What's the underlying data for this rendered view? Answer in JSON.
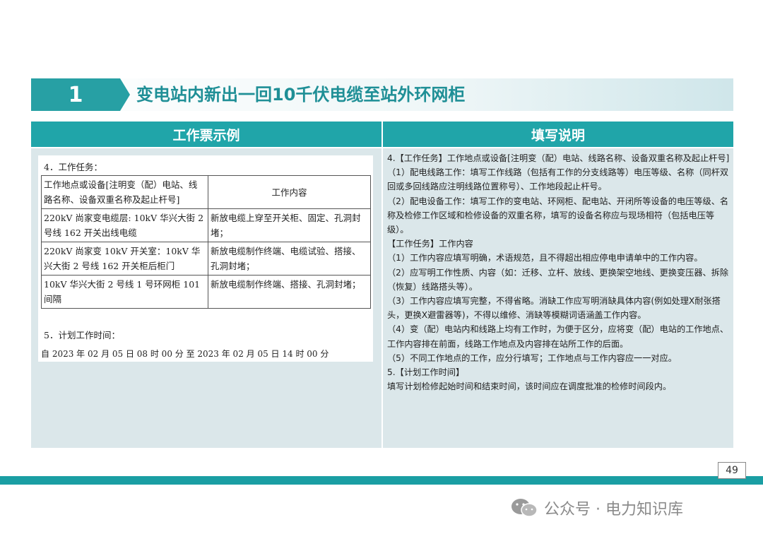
{
  "title": {
    "number": "1",
    "text": "变电站内新出一回10千伏电缆至站外环网柜"
  },
  "columns": {
    "left_header": "工作票示例",
    "right_header": "填写说明"
  },
  "example": {
    "section4": "4．工作任务：",
    "table_head": {
      "location": "工作地点或设备[注明变（配）电站、线路名称、设备双重名称及起止杆号]",
      "content": "工作内容"
    },
    "rows": [
      {
        "location": "220kV 尚家变电缆层: 10kV 华兴大街 2 号线 162 开关出线电缆",
        "content": "新放电缆上穿至开关柜、固定、孔洞封堵；"
      },
      {
        "location": "220kV 尚家变 10kV 开关室：10kV 华兴大街 2 号线 162 开关柜后柜门",
        "content": "新放电缆制作终端、电缆试验、搭接、孔洞封堵；"
      },
      {
        "location": "10kV 华兴大街 2 号线 1 号环网柜 101 间隔",
        "content": "新放电缆制作终端、搭接、孔洞封堵；"
      }
    ],
    "section5": "5．计划工作时间：",
    "time_line": "自 2023 年 02 月 05 日 08  时 00 分 至 2023 年 02 月 05 日 14 时 00 分"
  },
  "instructions": [
    "4.【工作任务】工作地点或设备[注明变（配）电站、线路名称、设备双重名称及起止杆号]",
    "（1）配电线路工作：填写工作线路（包括有工作的分支线路等）电压等级、名称（同杆双回或多回线路应注明线路位置称号）、工作地段起止杆号。",
    "（2）配电设备工作：填写工作的变电站、环网柜、配电站、开闭所等设备的电压等级、名称及检修工作区域和检修设备的双重名称，填写的设备名称应与现场相符（包括电压等级）。",
    "【工作任务】工作内容",
    "（1）工作内容应填写明确，术语规范，且不得超出相应停电申请单中的工作内容。",
    "（2）应写明工作性质、内容（如：迁移、立杆、放线、更换架空地线、更换变压器、拆除（恢复）线路搭头等）。",
    "（3）工作内容应填写完整，不得省略。消缺工作应写明消缺具体内容(例如处理X耐张搭头，更换X避雷器等)，不得以维修、消缺等模糊词语涵盖工作内容。",
    "（4）变（配）电站内和线路上均有工作时，为便于区分，应将变（配）电站的工作地点、工作内容排在前面，线路工作地点及内容排在站所工作的后面。",
    "（5）不同工作地点的工作，应分行填写；工作地点与工作内容应一一对应。",
    "5.【计划工作时间】",
    "填写计划检修起始时间和结束时间，该时间应在调度批准的检修时间段内。"
  ],
  "footer": {
    "page": "49",
    "wechat": "公众号 · 电力知识库"
  },
  "colors": {
    "teal": "#20a5a9",
    "title_text": "#1f8f96",
    "cell_bg": "#dbe7ea"
  }
}
